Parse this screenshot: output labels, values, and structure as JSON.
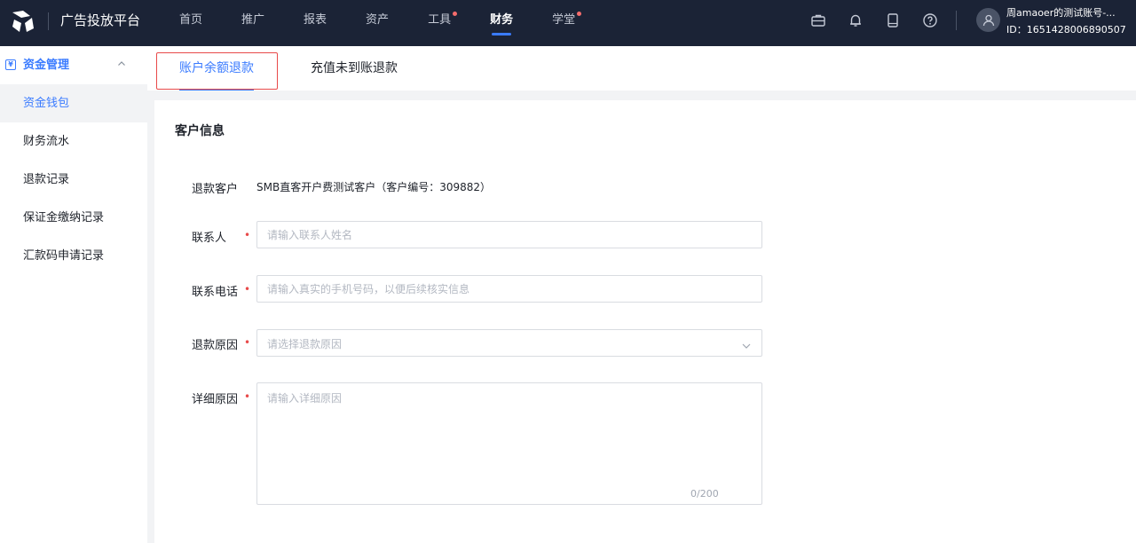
{
  "header": {
    "brand": "广告投放平台",
    "nav": [
      {
        "label": "首页",
        "active": false,
        "dot": false
      },
      {
        "label": "推广",
        "active": false,
        "dot": false
      },
      {
        "label": "报表",
        "active": false,
        "dot": false
      },
      {
        "label": "资产",
        "active": false,
        "dot": false
      },
      {
        "label": "工具",
        "active": false,
        "dot": true
      },
      {
        "label": "财务",
        "active": true,
        "dot": false
      },
      {
        "label": "学堂",
        "active": false,
        "dot": true
      }
    ],
    "icons": [
      "briefcase-icon",
      "bell-icon",
      "tablet-icon",
      "help-icon"
    ],
    "user": {
      "name": "周amaoer的测试账号-...",
      "id": "ID：1651428006890507"
    }
  },
  "sidebar": {
    "group_label": "资金管理",
    "items": [
      {
        "label": "资金钱包",
        "active": true
      },
      {
        "label": "财务流水",
        "active": false
      },
      {
        "label": "退款记录",
        "active": false
      },
      {
        "label": "保证金缴纳记录",
        "active": false
      },
      {
        "label": "汇款码申请记录",
        "active": false
      }
    ]
  },
  "tabs": [
    {
      "label": "账户余额退款",
      "active": true
    },
    {
      "label": "充值未到账退款",
      "active": false
    }
  ],
  "form": {
    "section_title": "客户信息",
    "customer_label": "退款客户",
    "customer_value": "SMB直客开户费测试客户（客户编号：309882）",
    "contact_label": "联系人",
    "contact_placeholder": "请输入联系人姓名",
    "phone_label": "联系电话",
    "phone_placeholder": "请输入真实的手机号码，以便后续核实信息",
    "reason_label": "退款原因",
    "reason_placeholder": "请选择退款原因",
    "detail_label": "详细原因",
    "detail_placeholder": "请输入详细原因",
    "detail_counter": "0/200",
    "required_mark": "•"
  },
  "colors": {
    "topbar": "#1b2336",
    "accent": "#3a7bff",
    "required": "#e84a4a",
    "highlight_border": "#e84a4a"
  }
}
